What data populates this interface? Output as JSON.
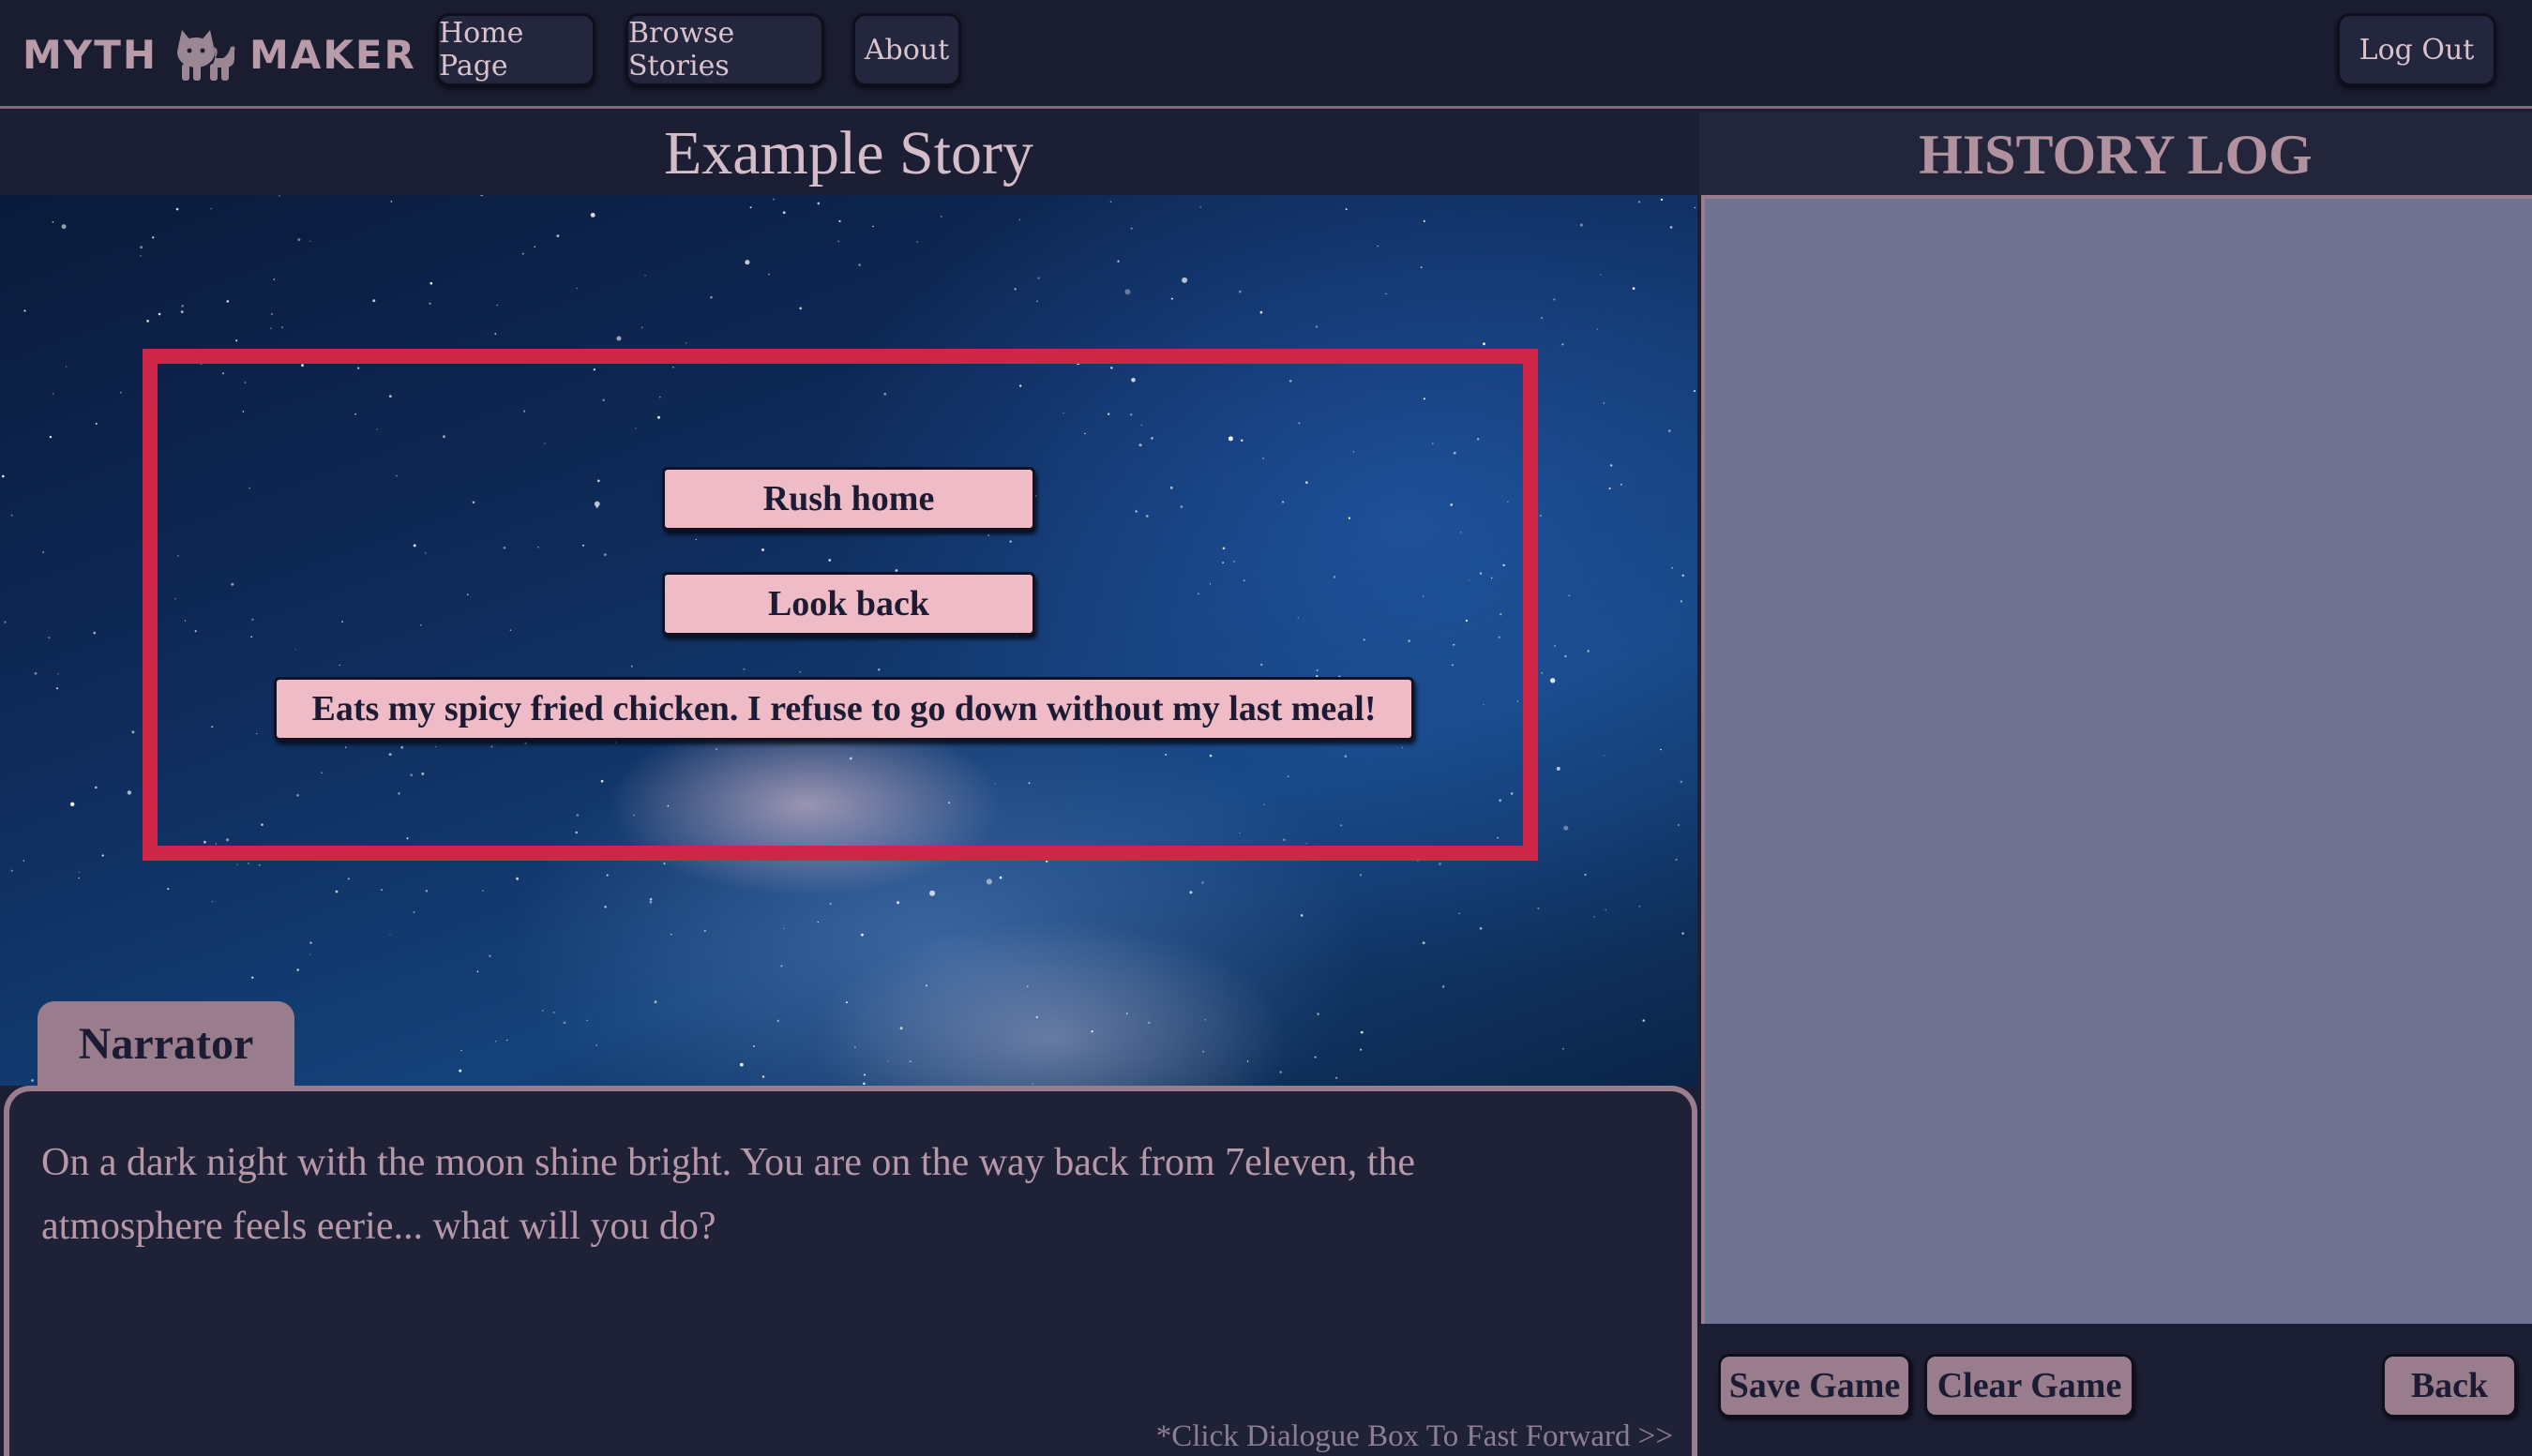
{
  "brand": {
    "name_left": "MYTH",
    "name_right": "MAKER",
    "logo_icon": "cat-icon"
  },
  "nav": {
    "home": "Home Page",
    "browse": "Browse Stories",
    "about": "About",
    "logout": "Log Out"
  },
  "story": {
    "title": "Example Story"
  },
  "choices": [
    "Rush home",
    "Look back",
    "Eats my spicy fried chicken. I refuse to go down without my last meal!"
  ],
  "dialogue": {
    "speaker": "Narrator",
    "text": "On a dark night with the moon shine bright. You are on the way back from 7eleven, the atmosphere feels eerie... what will you do?",
    "hint": "*Click Dialogue Box To Fast Forward >>"
  },
  "history": {
    "title": "HISTORY LOG",
    "save_label": "Save Game",
    "clear_label": "Clear Game",
    "back_label": "Back"
  },
  "colors": {
    "background": "#1c1e33",
    "accent_pink": "#eebbc6",
    "accent_mauve": "#9a7d8d",
    "choice_frame": "#cf2547",
    "history_panel": "#6f738f"
  }
}
